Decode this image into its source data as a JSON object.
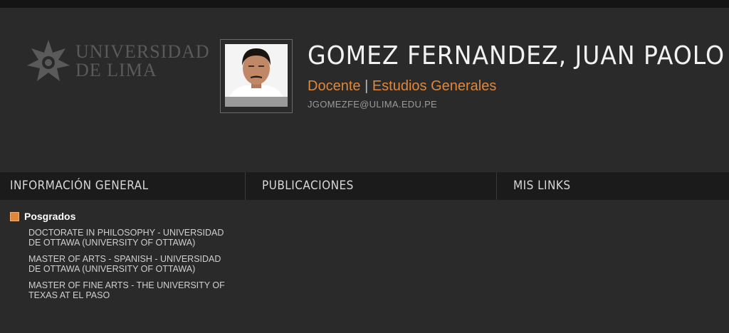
{
  "logo": {
    "line1": "UNIVERSIDAD",
    "line2": "DE LIMA",
    "icon": "university-star-logo-icon"
  },
  "profile": {
    "name": "GOMEZ FERNANDEZ, JUAN PAOLO",
    "role": "Docente",
    "separator": "|",
    "department": "Estudios Generales",
    "email": "JGOMEZFE@ULIMA.EDU.PE",
    "photo": "profile-photo"
  },
  "tabs": [
    {
      "label": "INFORMACIÓN GENERAL"
    },
    {
      "label": "PUBLICACIONES"
    },
    {
      "label": "MIS LINKS"
    }
  ],
  "posgrados": {
    "title": "Posgrados",
    "items": [
      "DOCTORATE IN PHILOSOPHY - UNIVERSIDAD DE OTTAWA (UNIVERSITY OF OTTAWA)",
      "MASTER OF ARTS - SPANISH - UNIVERSIDAD DE OTTAWA (UNIVERSITY OF OTTAWA)",
      "MASTER OF FINE ARTS - THE UNIVERSITY OF TEXAS AT EL PASO"
    ]
  },
  "colors": {
    "accent": "#e0873a",
    "background": "#2a2a2a",
    "tabbar": "#1b1b1b"
  }
}
